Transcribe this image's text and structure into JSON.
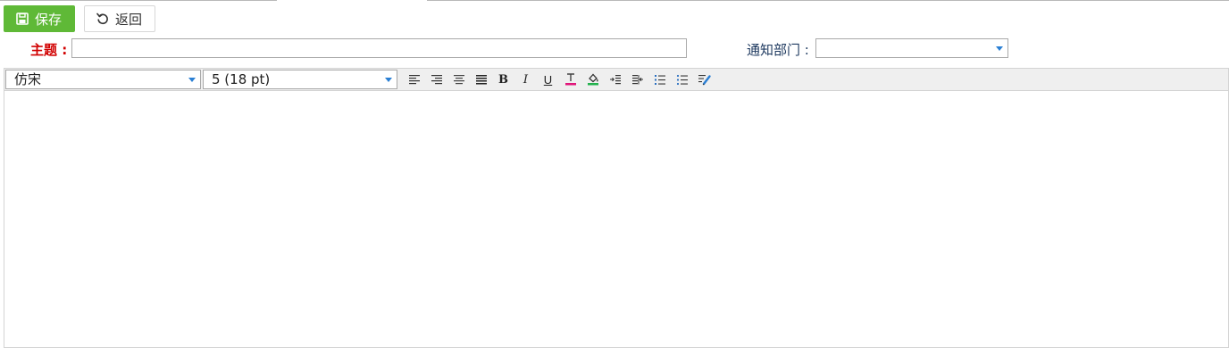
{
  "toolbar": {
    "save_label": "保存",
    "back_label": "返回"
  },
  "form": {
    "subject_label": "主题 :",
    "subject_value": "",
    "dept_label": "通知部门 :",
    "dept_value": ""
  },
  "editor": {
    "font_family": "仿宋",
    "font_size": "5 (18 pt)",
    "tools": [
      {
        "name": "align-left-icon"
      },
      {
        "name": "align-right-icon"
      },
      {
        "name": "align-center-icon"
      },
      {
        "name": "align-justify-icon"
      },
      {
        "name": "bold-icon"
      },
      {
        "name": "italic-icon"
      },
      {
        "name": "underline-icon"
      },
      {
        "name": "text-color-icon"
      },
      {
        "name": "highlight-color-icon"
      },
      {
        "name": "indent-icon"
      },
      {
        "name": "outdent-icon"
      },
      {
        "name": "ordered-list-icon"
      },
      {
        "name": "unordered-list-icon"
      },
      {
        "name": "remove-format-icon"
      }
    ]
  },
  "colors": {
    "save_button": "#5fb937",
    "required_label": "#d10000",
    "label_blue": "#1f3a60",
    "dropdown_caret": "#2a7fd4",
    "text_color_bar": "#e0157a",
    "highlight_bar": "#22b14c"
  }
}
